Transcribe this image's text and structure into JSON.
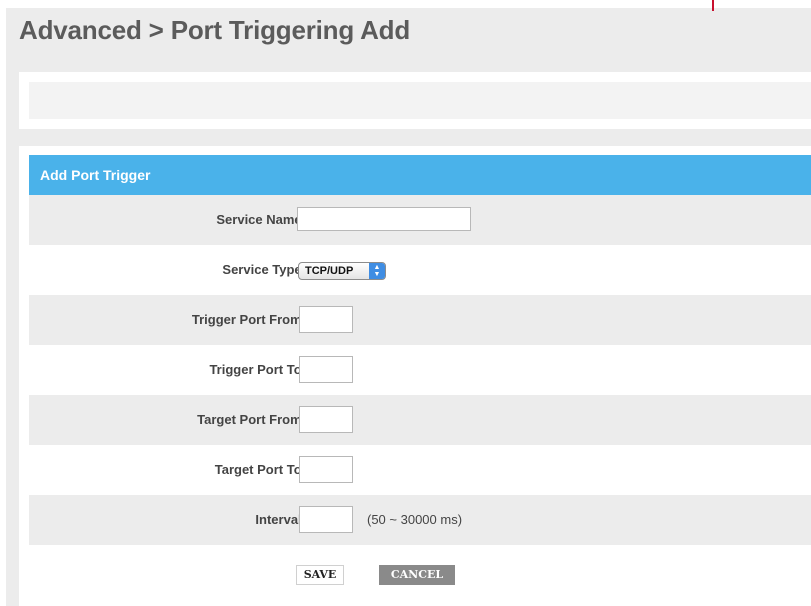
{
  "page": {
    "title": "Advanced > Port Triggering Add"
  },
  "section": {
    "title": "Add Port Trigger"
  },
  "form": {
    "service_name": {
      "label": "Service Name:",
      "value": ""
    },
    "service_type": {
      "label": "Service Type:",
      "selected": "TCP/UDP"
    },
    "trigger_port_from": {
      "label": "Trigger Port From:",
      "value": ""
    },
    "trigger_port_to": {
      "label": "Trigger Port To:",
      "value": ""
    },
    "target_port_from": {
      "label": "Target Port From:",
      "value": ""
    },
    "target_port_to": {
      "label": "Target Port To:",
      "value": ""
    },
    "interval": {
      "label": "Interval:",
      "value": "",
      "hint": "(50 ~ 30000 ms)"
    }
  },
  "buttons": {
    "save": "SAVE",
    "cancel": "CANCEL"
  },
  "icons": {
    "select_arrows": "select-updown-icon"
  },
  "colors": {
    "header": "#4ab2ea",
    "accent_mark": "#c8102e",
    "cancel_bg": "#8a8a8a"
  }
}
